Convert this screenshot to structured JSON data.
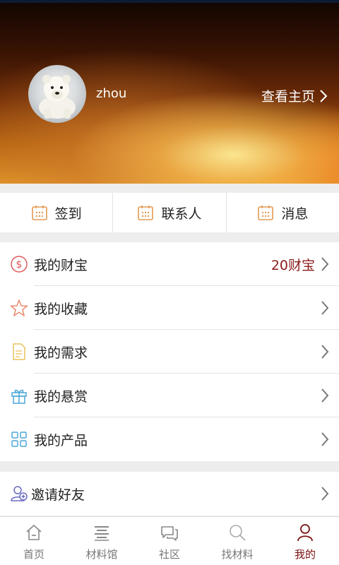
{
  "profile": {
    "username": "zhou",
    "view_homepage": "查看主页"
  },
  "quick_actions": [
    {
      "label": "签到",
      "icon": "calendar-icon"
    },
    {
      "label": "联系人",
      "icon": "calendar-icon"
    },
    {
      "label": "消息",
      "icon": "calendar-icon"
    }
  ],
  "menu": [
    {
      "label": "我的财宝",
      "value": "20财宝",
      "icon": "dollar-icon"
    },
    {
      "label": "我的收藏",
      "icon": "star-icon"
    },
    {
      "label": "我的需求",
      "icon": "document-icon"
    },
    {
      "label": "我的悬赏",
      "icon": "gift-icon"
    },
    {
      "label": "我的产品",
      "icon": "grid-icon"
    }
  ],
  "invite": {
    "label": "邀请好友",
    "icon": "add-contact-icon"
  },
  "tabbar": [
    {
      "label": "首页",
      "icon": "home-icon",
      "active": false
    },
    {
      "label": "材料馆",
      "icon": "list-icon",
      "active": false
    },
    {
      "label": "社区",
      "icon": "chat-icon",
      "active": false
    },
    {
      "label": "找材料",
      "icon": "search-icon",
      "active": false
    },
    {
      "label": "我的",
      "icon": "person-icon",
      "active": true
    }
  ],
  "colors": {
    "accent": "#7a1212",
    "value_text": "#8b1c1c",
    "calendar_icon": "#e59a52"
  }
}
